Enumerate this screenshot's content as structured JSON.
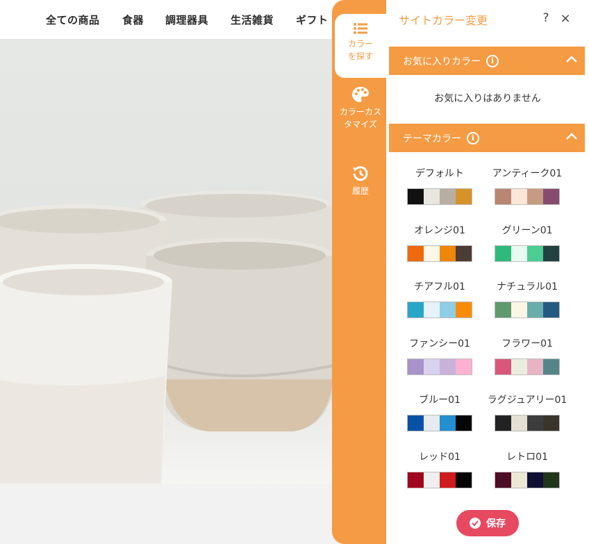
{
  "site": {
    "nav": [
      "全ての商品",
      "食器",
      "調理器具",
      "生活雑貨",
      "ギフト"
    ]
  },
  "panel": {
    "title": "サイトカラー変更",
    "help_label": "?",
    "close_label": "×",
    "tabs": [
      {
        "label": "カラーを探す",
        "icon": "list-icon",
        "active": true
      },
      {
        "label": "カラーカスタマイズ",
        "icon": "palette-icon",
        "active": false
      },
      {
        "label": "履歴",
        "icon": "history-icon",
        "active": false
      }
    ],
    "favorites": {
      "header": "お気に入りカラー",
      "empty_text": "お気に入りはありません",
      "expanded": true
    },
    "themes_section": {
      "header": "テーマカラー",
      "expanded": true
    },
    "themes": [
      {
        "name": "デフォルト",
        "colors": [
          "#111111",
          "#e8e6e1",
          "#b7ada3",
          "#d6932a"
        ]
      },
      {
        "name": "アンティーク01",
        "colors": [
          "#b98672",
          "#fde6d7",
          "#c79b83",
          "#864c6f"
        ]
      },
      {
        "name": "オレンジ01",
        "colors": [
          "#f0690c",
          "#fdf7e8",
          "#ee8609",
          "#4b3c34"
        ]
      },
      {
        "name": "グリーン01",
        "colors": [
          "#30b97d",
          "#e9fbf1",
          "#4bcd94",
          "#234140"
        ]
      },
      {
        "name": "チアフル01",
        "colors": [
          "#28a6c8",
          "#e6f2f5",
          "#8fcde7",
          "#f98b0a"
        ]
      },
      {
        "name": "ナチュラル01",
        "colors": [
          "#5f9a6f",
          "#fbf6e3",
          "#68ada9",
          "#245a82"
        ]
      },
      {
        "name": "ファンシー01",
        "colors": [
          "#a793c9",
          "#d8d2ee",
          "#c9b2da",
          "#fbb1d2"
        ]
      },
      {
        "name": "フラワー01",
        "colors": [
          "#d9587a",
          "#eaeedf",
          "#e6b4c5",
          "#548689"
        ]
      },
      {
        "name": "ブルー01",
        "colors": [
          "#0851a6",
          "#e7eaee",
          "#248ed2",
          "#060606"
        ]
      },
      {
        "name": "ラグジュアリー01",
        "colors": [
          "#222222",
          "#e6e0d4",
          "#3d3d3d",
          "#3b342b"
        ]
      },
      {
        "name": "レッド01",
        "colors": [
          "#a0061d",
          "#efefef",
          "#cf1b1d",
          "#050505"
        ]
      },
      {
        "name": "レトロ01",
        "colors": [
          "#4c0e24",
          "#ece8d4",
          "#101035",
          "#213519"
        ]
      }
    ],
    "save_label": "保存",
    "accent_color": "#f59b44",
    "save_color": "#e64960"
  }
}
